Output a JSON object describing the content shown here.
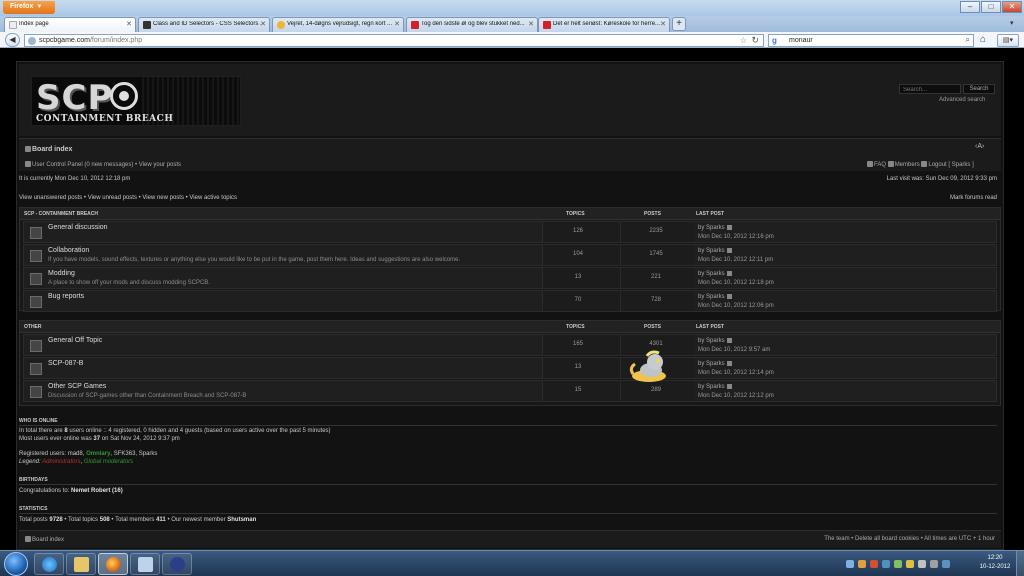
{
  "browser": {
    "app_button": "Firefox",
    "tabs": [
      {
        "label": "Index page",
        "active": true
      },
      {
        "label": "Class and ID Selectors - CSS Selectors ...",
        "active": false
      },
      {
        "label": "Vejret, 14-døgns vejrudsigt, regn kort ...",
        "active": false
      },
      {
        "label": "Tog den sidste øl og blev stukket ned...",
        "active": false
      },
      {
        "label": "Det er helt seriøst: Køreskole for herre...",
        "active": false
      }
    ],
    "url_host": "scpcbgame.com",
    "url_path": "/forum/index.php",
    "search_engine_glyph": "g",
    "search_query": "monaur"
  },
  "header": {
    "logo_main": "SCP",
    "logo_sub": "CONTAINMENT BREACH",
    "search_placeholder": "Search...",
    "search_button": "Search",
    "advanced_search": "Advanced search"
  },
  "nav": {
    "board_index": "Board index",
    "font_size": "‹A›",
    "ucp": "User Control Panel (0 new messages) • View your posts",
    "faq": "FAQ",
    "members": "Members",
    "logout": "Logout [ Sparks ]"
  },
  "status": {
    "current_time": "It is currently Mon Dec 10, 2012 12:18 pm",
    "last_visit": "Last visit was: Sun Dec 09, 2012 9:33 pm",
    "quick_links": "View unanswered posts • View unread posts • View new posts • View active topics",
    "mark_read": "Mark forums read"
  },
  "categories": [
    {
      "name": "SCP - CONTAINMENT BREACH",
      "col_topics": "TOPICS",
      "col_posts": "POSTS",
      "col_last": "LAST POST",
      "forums": [
        {
          "title": "General discussion",
          "desc": "",
          "topics": "126",
          "posts": "2235",
          "last_by": "by Sparks",
          "last_date": "Mon Dec 10, 2012 12:16 pm"
        },
        {
          "title": "Collaboration",
          "desc": "If you have models, sound effects, textures or anything else you would like to be put in the game, post them here. Ideas and suggestions are also welcome.",
          "topics": "104",
          "posts": "1745",
          "last_by": "by Sparks",
          "last_date": "Mon Dec 10, 2012 12:11 pm"
        },
        {
          "title": "Modding",
          "desc": "A place to show off your mods and discuss modding SCPCB.",
          "topics": "13",
          "posts": "221",
          "last_by": "by Sparks",
          "last_date": "Mon Dec 10, 2012 12:18 pm"
        },
        {
          "title": "Bug reports",
          "desc": "",
          "topics": "70",
          "posts": "728",
          "last_by": "by Sparks",
          "last_date": "Mon Dec 10, 2012 12:06 pm"
        }
      ]
    },
    {
      "name": "OTHER",
      "col_topics": "TOPICS",
      "col_posts": "POSTS",
      "col_last": "LAST POST",
      "forums": [
        {
          "title": "General Off Topic",
          "desc": "",
          "topics": "165",
          "posts": "4301",
          "last_by": "by Sparks",
          "last_date": "Mon Dec 10, 2012 9:57 am"
        },
        {
          "title": "SCP-087-B",
          "desc": "",
          "topics": "13",
          "posts": "",
          "last_by": "by Sparks",
          "last_date": "Mon Dec 10, 2012 12:14 pm"
        },
        {
          "title": "Other SCP Games",
          "desc": "Discussion of SCP-games other than Containment Breach and SCP-087-B",
          "topics": "15",
          "posts": "289",
          "last_by": "by Sparks",
          "last_date": "Mon Dec 10, 2012 12:12 pm"
        }
      ]
    }
  ],
  "online": {
    "title": "WHO IS ONLINE",
    "line1_a": "In total there are ",
    "line1_count": "8",
    "line1_b": " users online :: 4 registered, 0 hidden and 4 guests (based on users active over the past 5 minutes)",
    "line2_a": "Most users ever online was ",
    "line2_count": "37",
    "line2_b": " on Sat Nov 24, 2012 9:37 pm",
    "reg_label": "Registered users: ",
    "reg_user1": "mad8",
    "reg_user2": "Omniary",
    "reg_rest": ", SFK363, Sparks",
    "legend_label": "Legend: ",
    "legend_admin": "Administrators",
    "legend_gmod": "Global moderators"
  },
  "birthdays": {
    "title": "BIRTHDAYS",
    "text": "Congratulations to: ",
    "name": "Nemet Robert (16)"
  },
  "statistics": {
    "title": "STATISTICS",
    "posts_label": "Total posts ",
    "posts": "9728",
    "topics_label": " • Total topics ",
    "topics": "508",
    "members_label": " • Total members ",
    "members": "411",
    "newest_label": " • Our newest member ",
    "newest": "Shutsman"
  },
  "footer": {
    "board_index": "Board index",
    "links": "The team • Delete all board cookies • All times are UTC + 1 hour"
  },
  "taskbar": {
    "time": "12:20",
    "date": "10-12-2012"
  },
  "colors": {
    "accent_admin": "#b9342a",
    "accent_gmod": "#2f9b2f",
    "firefox_orange": "#e2741a"
  }
}
